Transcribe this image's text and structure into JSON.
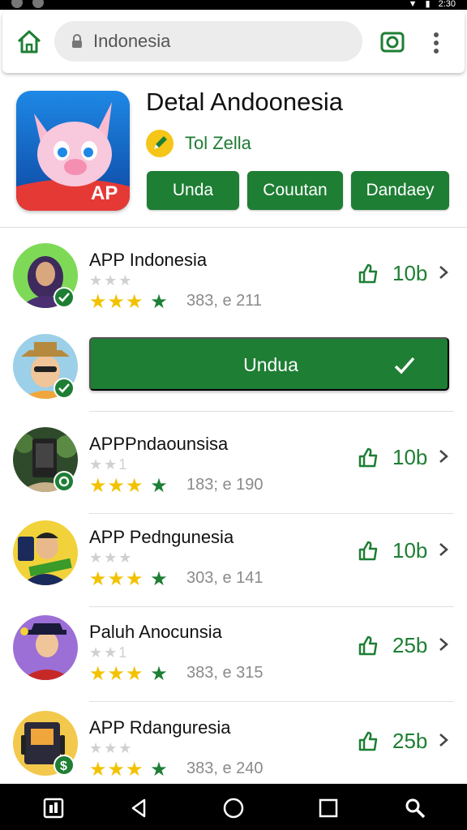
{
  "statusbar": {
    "time": "2:30"
  },
  "topbar": {
    "home_icon": "home-icon",
    "search_value": "Indonesia",
    "lock_icon": "lock-icon",
    "camera_icon": "camera-icon",
    "menu_icon": "more-vert-icon"
  },
  "hero": {
    "title": "Detal Andoonesia",
    "developer": "Tol Zella",
    "app_icon_text": "AP",
    "buttons": [
      "Unda",
      "Couutan",
      "Dandaey"
    ]
  },
  "apps": [
    {
      "name": "APP Indonesia",
      "grey_stars": "★★★",
      "meta": "383, e 211",
      "count": "10b"
    },
    {
      "install_label": "Undua"
    },
    {
      "name": "APPPndaounsisa",
      "grey_stars": "★★1",
      "meta": "183; e 190",
      "count": "10b"
    },
    {
      "name": "APP Pedngunesia",
      "grey_stars": "★★★",
      "meta": "303, e 141",
      "count": "10b"
    },
    {
      "name": "Paluh Anocunsia",
      "grey_stars": "★★1",
      "meta": "383, e 315",
      "count": "25b"
    },
    {
      "name": "APP Rdanguresia",
      "grey_stars": "★★★",
      "meta": "383, e 240",
      "count": "25b"
    }
  ],
  "colors": {
    "accent": "#1e7e34",
    "star": "#f2c200",
    "hero_icon_bg": "#1565c0"
  },
  "navbar": {
    "icons": [
      "recents-app-icon",
      "back-icon",
      "home-circle-icon",
      "overview-icon",
      "search-icon"
    ]
  }
}
